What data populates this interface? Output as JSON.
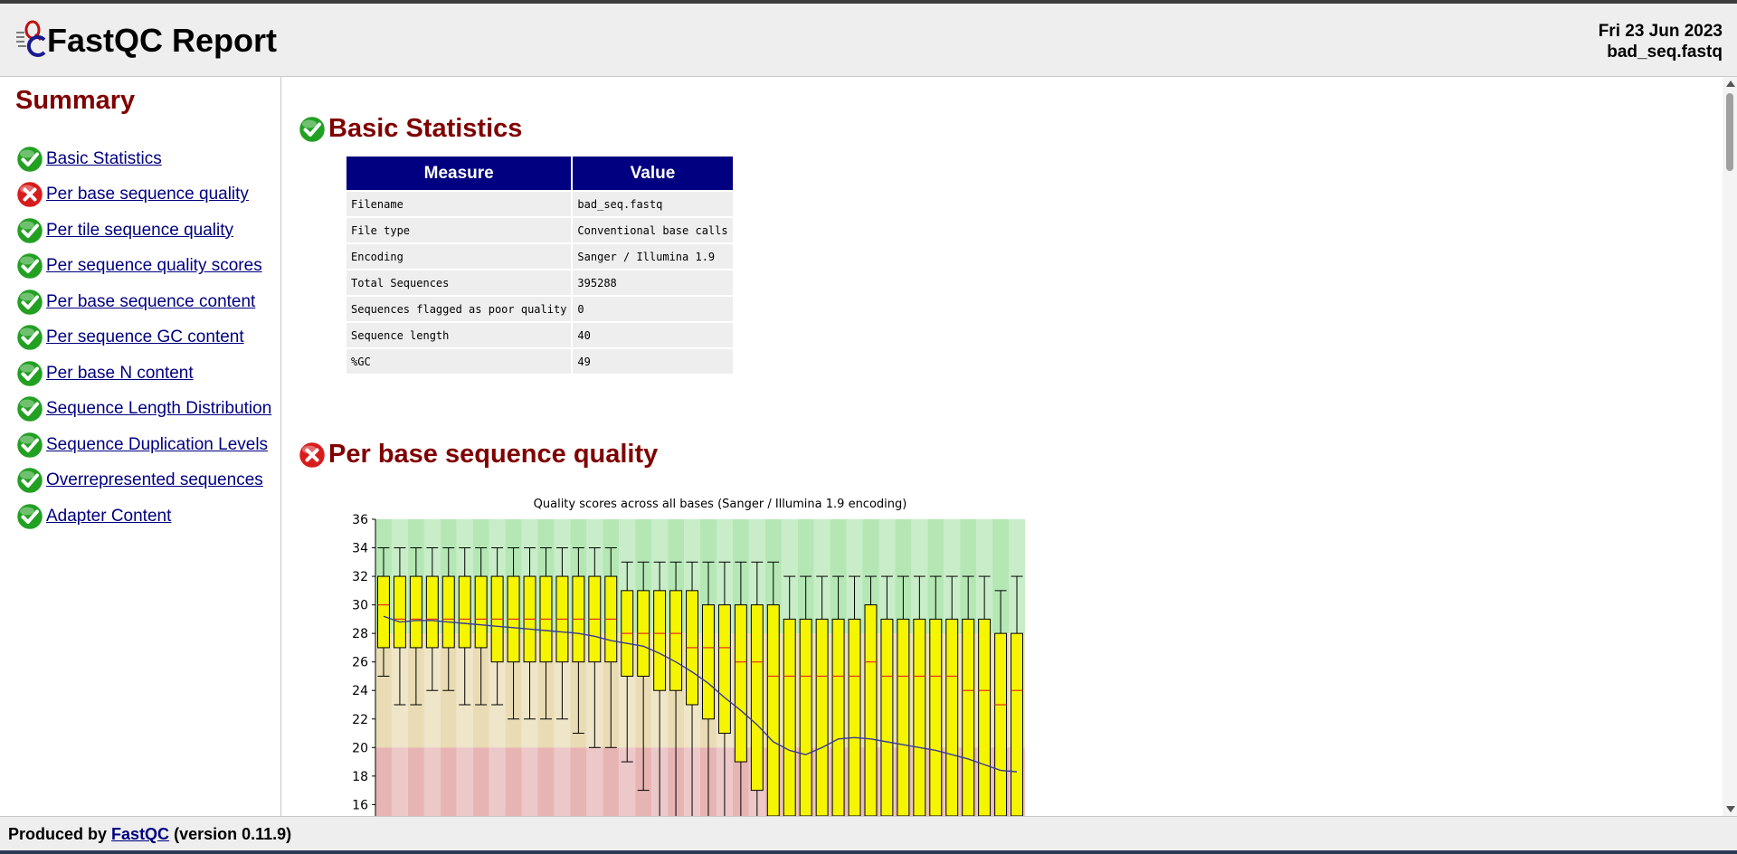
{
  "header": {
    "title": "FastQC Report",
    "date": "Fri 23 Jun 2023",
    "filename": "bad_seq.fastq"
  },
  "summary": {
    "title": "Summary",
    "items": [
      {
        "label": "Basic Statistics",
        "status": "pass"
      },
      {
        "label": "Per base sequence quality",
        "status": "fail"
      },
      {
        "label": "Per tile sequence quality",
        "status": "pass"
      },
      {
        "label": "Per sequence quality scores",
        "status": "pass"
      },
      {
        "label": "Per base sequence content",
        "status": "pass"
      },
      {
        "label": "Per sequence GC content",
        "status": "pass"
      },
      {
        "label": "Per base N content",
        "status": "pass"
      },
      {
        "label": "Sequence Length Distribution",
        "status": "pass"
      },
      {
        "label": "Sequence Duplication Levels",
        "status": "pass"
      },
      {
        "label": "Overrepresented sequences",
        "status": "pass"
      },
      {
        "label": "Adapter Content",
        "status": "pass"
      }
    ]
  },
  "basic_stats": {
    "title": "Basic Statistics",
    "status": "pass",
    "headers": [
      "Measure",
      "Value"
    ],
    "rows": [
      [
        "Filename",
        "bad_seq.fastq"
      ],
      [
        "File type",
        "Conventional base calls"
      ],
      [
        "Encoding",
        "Sanger / Illumina 1.9"
      ],
      [
        "Total Sequences",
        "395288"
      ],
      [
        "Sequences flagged as poor quality",
        "0"
      ],
      [
        "Sequence length",
        "40"
      ],
      [
        "%GC",
        "49"
      ]
    ]
  },
  "per_base_quality": {
    "title": "Per base sequence quality",
    "status": "fail"
  },
  "footer": {
    "prefix": "Produced by",
    "link": "FastQC",
    "suffix": "(version 0.11.9)"
  },
  "colors": {
    "title_red": "#800000",
    "link_blue": "#000080",
    "table_header": "#000080",
    "box_yellow": "#f5f500",
    "median_red": "#e03020",
    "mean_line": "#3a3a9a",
    "zone_good": "#b0e6b0",
    "zone_ok": "#e8dab0",
    "zone_bad": "#e6b0b0"
  },
  "chart_data": {
    "type": "boxplot",
    "title": "Quality scores across all bases (Sanger / Illumina 1.9 encoding)",
    "ylim_visible": [
      15.2,
      36
    ],
    "yticks": [
      16,
      18,
      20,
      22,
      24,
      26,
      28,
      30,
      32,
      34,
      36
    ],
    "zones": [
      {
        "name": "good",
        "from": 28,
        "to": 36
      },
      {
        "name": "reasonable",
        "from": 20,
        "to": 28
      },
      {
        "name": "poor",
        "from": 0,
        "to": 20
      }
    ],
    "positions": 40,
    "lower_whisker": [
      25,
      23,
      23,
      24,
      24,
      23,
      23,
      23,
      22,
      22,
      22,
      22,
      21,
      20,
      20,
      19,
      17,
      15,
      15,
      15,
      15,
      15,
      15,
      15,
      15,
      15,
      15,
      15,
      15,
      15,
      15,
      15,
      15,
      15,
      15,
      15,
      15,
      15,
      15,
      15
    ],
    "q1": [
      27,
      27,
      27,
      27,
      27,
      27,
      27,
      26,
      26,
      26,
      26,
      26,
      26,
      26,
      26,
      25,
      25,
      24,
      24,
      23,
      22,
      21,
      19,
      17,
      15,
      15,
      15,
      15,
      15,
      15,
      15,
      15,
      15,
      15,
      15,
      15,
      15,
      15,
      15,
      15
    ],
    "median": [
      30,
      29,
      29,
      29,
      29,
      29,
      29,
      29,
      29,
      29,
      29,
      29,
      29,
      29,
      29,
      28,
      28,
      28,
      28,
      27,
      27,
      27,
      26,
      26,
      25,
      25,
      25,
      25,
      25,
      25,
      26,
      25,
      25,
      25,
      25,
      25,
      24,
      24,
      23,
      24
    ],
    "q3": [
      32,
      32,
      32,
      32,
      32,
      32,
      32,
      32,
      32,
      32,
      32,
      32,
      32,
      32,
      32,
      31,
      31,
      31,
      31,
      31,
      30,
      30,
      30,
      30,
      30,
      29,
      29,
      29,
      29,
      29,
      30,
      29,
      29,
      29,
      29,
      29,
      29,
      29,
      28,
      28
    ],
    "upper_whisker": [
      34,
      34,
      34,
      34,
      34,
      34,
      34,
      34,
      34,
      34,
      34,
      34,
      34,
      34,
      34,
      33,
      33,
      33,
      33,
      33,
      33,
      33,
      33,
      33,
      33,
      32,
      32,
      32,
      32,
      32,
      32,
      32,
      32,
      32,
      32,
      32,
      32,
      32,
      31,
      32
    ],
    "mean": [
      29.2,
      28.8,
      28.9,
      28.9,
      28.8,
      28.7,
      28.6,
      28.5,
      28.4,
      28.3,
      28.2,
      28.1,
      28.0,
      27.8,
      27.5,
      27.3,
      27.1,
      26.6,
      26.0,
      25.3,
      24.5,
      23.5,
      22.6,
      21.6,
      20.4,
      19.8,
      19.5,
      20.0,
      20.6,
      20.7,
      20.6,
      20.4,
      20.2,
      20.0,
      19.8,
      19.5,
      19.2,
      18.8,
      18.4,
      18.3
    ]
  }
}
